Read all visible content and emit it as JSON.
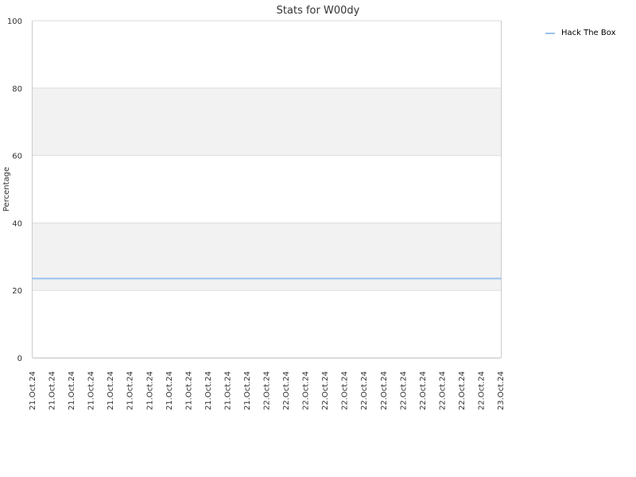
{
  "chart_data": {
    "type": "line",
    "title": "Stats for W00dy",
    "xlabel": "",
    "ylabel": "Percentage",
    "ylim": [
      0,
      100
    ],
    "yticks": [
      0,
      20,
      40,
      60,
      80,
      100
    ],
    "grid": true,
    "legend": {
      "placement": "top-right",
      "entries": [
        "Hack The Box"
      ]
    },
    "x": [
      "21.Oct.24",
      "21.Oct.24",
      "21.Oct.24",
      "21.Oct.24",
      "21.Oct.24",
      "21.Oct.24",
      "21.Oct.24",
      "21.Oct.24",
      "21.Oct.24",
      "21.Oct.24",
      "21.Oct.24",
      "21.Oct.24",
      "22.Oct.24",
      "22.Oct.24",
      "22.Oct.24",
      "22.Oct.24",
      "22.Oct.24",
      "22.Oct.24",
      "22.Oct.24",
      "22.Oct.24",
      "22.Oct.24",
      "22.Oct.24",
      "22.Oct.24",
      "22.Oct.24",
      "23.Oct.24"
    ],
    "series": [
      {
        "name": "Hack The Box",
        "color": "#99c2ee",
        "values": [
          23.5,
          23.5,
          23.5,
          23.5,
          23.5,
          23.5,
          23.5,
          23.5,
          23.5,
          23.5,
          23.5,
          23.5,
          23.5,
          23.5,
          23.5,
          23.5,
          23.5,
          23.5,
          23.5,
          23.5,
          23.5,
          23.5,
          23.5,
          23.5,
          23.5
        ]
      }
    ]
  },
  "colors": {
    "band": "#f2f2f2",
    "grid": "#dddddd",
    "axis": "#cccccc"
  }
}
